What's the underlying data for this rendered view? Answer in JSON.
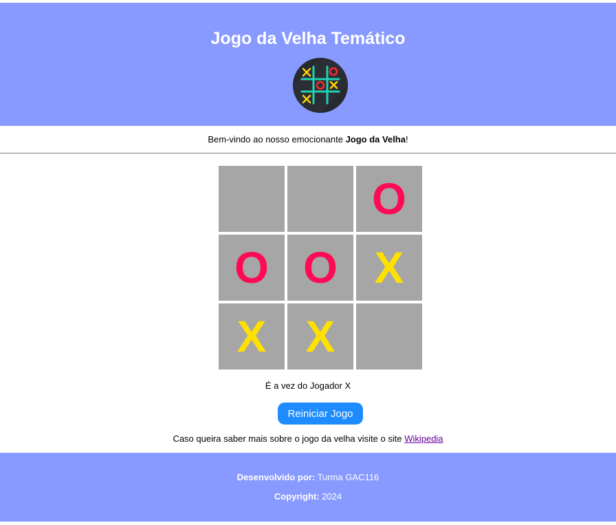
{
  "header": {
    "title": "Jogo da Velha Temático",
    "logo_icon": "tic-tac-toe-logo-icon"
  },
  "welcome": {
    "prefix": "Bem-vindo ao nosso emocionante ",
    "bold": "Jogo da Velha",
    "suffix": "!"
  },
  "board": {
    "cells": [
      "",
      "",
      "O",
      "O",
      "O",
      "X",
      "X",
      "X",
      ""
    ],
    "colors": {
      "X": "#ffe100",
      "O": "#ff0a54",
      "cell_bg": "#a6a6a6"
    }
  },
  "status": "É a vez do Jogador X",
  "reset_button": "Reiniciar Jogo",
  "info": {
    "text": "Caso queira saber mais sobre o jogo da velha visite o site ",
    "link_text": "Wikipedia"
  },
  "footer": {
    "dev_label": "Desenvolvido por:",
    "dev_value": " Turma GAC116",
    "copyright_label": "Copyright:",
    "copyright_value": " 2024"
  },
  "colors": {
    "header_bg": "#8899ff",
    "button_bg": "#1e8cff"
  }
}
